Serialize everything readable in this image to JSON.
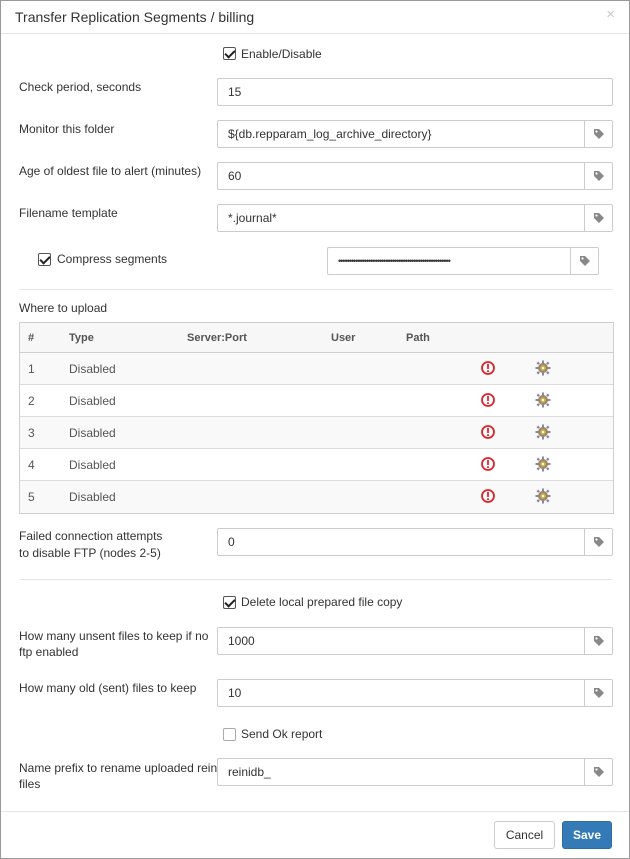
{
  "dialog": {
    "title": "Transfer Replication Segments / billing",
    "close_glyph": "×"
  },
  "form": {
    "enable": {
      "label": "Enable/Disable",
      "checked": true
    },
    "check_period": {
      "label": "Check period, seconds",
      "value": "15"
    },
    "monitor_folder": {
      "label": "Monitor this folder",
      "value": "${db.repparam_log_archive_directory}"
    },
    "oldest_file_age": {
      "label": "Age of oldest file to alert (minutes)",
      "value": "60"
    },
    "filename_template": {
      "label": "Filename template",
      "value": "*.journal*"
    },
    "compress": {
      "label": "Compress segments",
      "checked": true,
      "value": "••••••••••••••••••••••••••••••••••••••••••••••••••••"
    },
    "upload": {
      "label": "Where to upload",
      "columns": [
        "#",
        "Type",
        "Server:Port",
        "User",
        "Path"
      ],
      "rows": [
        {
          "num": "1",
          "type": "Disabled"
        },
        {
          "num": "2",
          "type": "Disabled"
        },
        {
          "num": "3",
          "type": "Disabled"
        },
        {
          "num": "4",
          "type": "Disabled"
        },
        {
          "num": "5",
          "type": "Disabled"
        }
      ]
    },
    "failed_attempts": {
      "label_line1": "Failed connection attempts",
      "label_line2": "to disable FTP (nodes 2-5)",
      "value": "0"
    },
    "delete_copy": {
      "label": "Delete local prepared file copy",
      "checked": true
    },
    "unsent_files": {
      "label_line1": "How many unsent files to keep if no",
      "label_line2": "ftp enabled",
      "value": "1000"
    },
    "old_files": {
      "label": "How many old (sent) files to keep",
      "value": "10"
    },
    "send_ok": {
      "label": "Send Ok report",
      "checked": false
    },
    "name_prefix": {
      "label_line1": "Name prefix to rename uploaded reini",
      "label_line2": "files",
      "value": "reinidb_"
    }
  },
  "footer": {
    "cancel_label": "Cancel",
    "save_label": "Save"
  },
  "colors": {
    "primary": "#337ab7",
    "error": "#d9262e",
    "gear": "#8a8a8a",
    "gear_center": "#e0a020"
  },
  "icons": [
    "tag-icon",
    "error-icon",
    "gear-icon",
    "checkbox-icon",
    "close-icon"
  ]
}
